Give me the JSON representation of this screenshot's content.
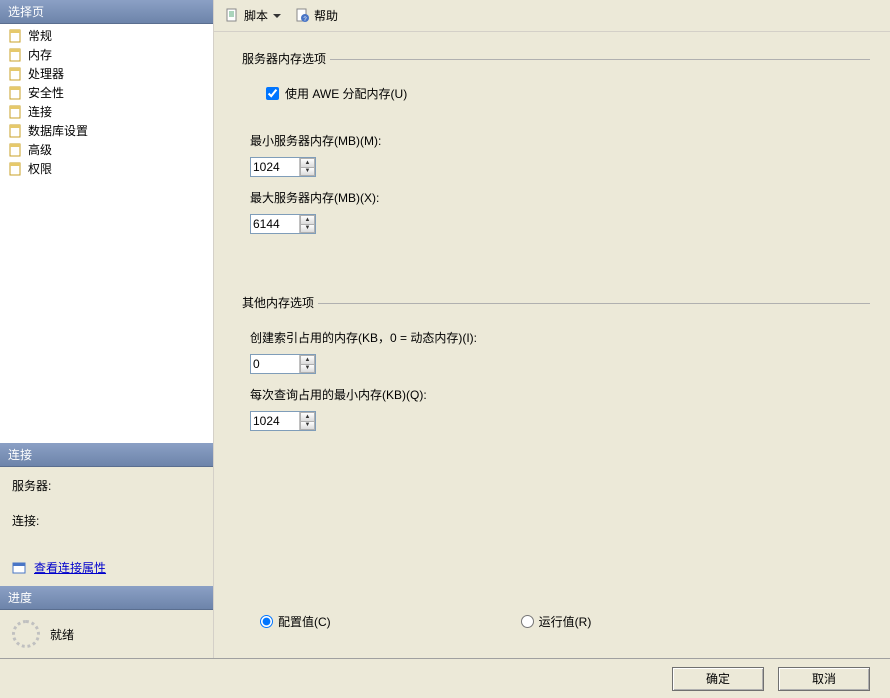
{
  "left": {
    "select_page_header": "选择页",
    "nav_items": [
      {
        "label": "常规"
      },
      {
        "label": "内存"
      },
      {
        "label": "处理器"
      },
      {
        "label": "安全性"
      },
      {
        "label": "连接"
      },
      {
        "label": "数据库设置"
      },
      {
        "label": "高级"
      },
      {
        "label": "权限"
      }
    ],
    "connection_header": "连接",
    "server_label": "服务器:",
    "server_value": "",
    "connection_label": "连接:",
    "connection_value": "",
    "view_conn_props_link": "查看连接属性",
    "progress_header": "进度",
    "progress_status": "就绪"
  },
  "toolbar": {
    "script_label": "脚本",
    "help_label": "帮助"
  },
  "server_memory": {
    "legend": "服务器内存选项",
    "awe_checkbox_label": "使用 AWE 分配内存(U)",
    "awe_checked": true,
    "min_label": "最小服务器内存(MB)(M):",
    "min_value": "1024",
    "max_label": "最大服务器内存(MB)(X):",
    "max_value": "6144"
  },
  "other_memory": {
    "legend": "其他内存选项",
    "index_label": "创建索引占用的内存(KB，0 = 动态内存)(I):",
    "index_value": "0",
    "query_label": "每次查询占用的最小内存(KB)(Q):",
    "query_value": "1024"
  },
  "view_mode": {
    "configured_label": "配置值(C)",
    "running_label": "运行值(R)",
    "selected": "configured"
  },
  "buttons": {
    "ok": "确定",
    "cancel": "取消"
  }
}
